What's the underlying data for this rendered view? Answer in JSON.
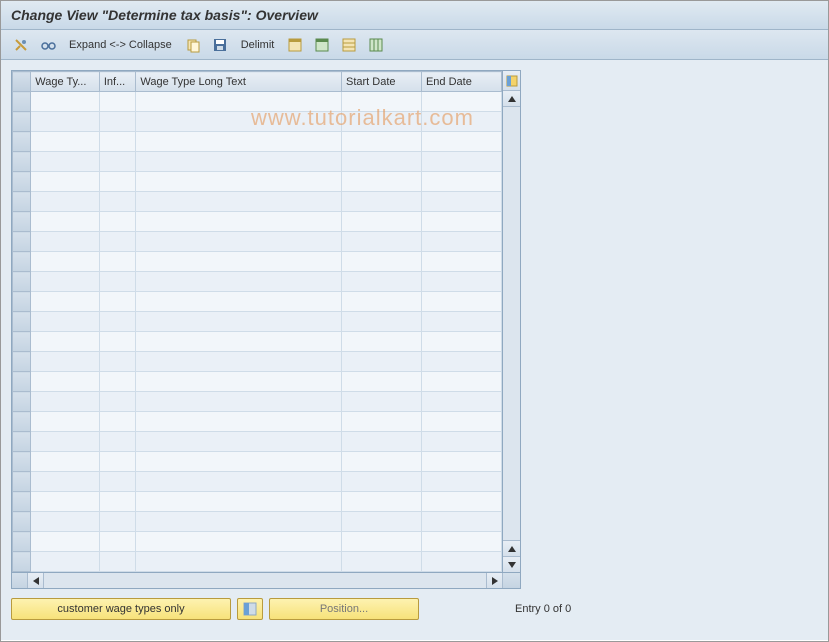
{
  "title": "Change View \"Determine tax basis\": Overview",
  "toolbar": {
    "expand_label": "Expand <-> Collapse",
    "delimit_label": "Delimit"
  },
  "table": {
    "columns": [
      "Wage Ty...",
      "Inf...",
      "Wage Type Long Text",
      "Start Date",
      "End Date"
    ],
    "rows": 24
  },
  "footer": {
    "customer_btn": "customer wage types only",
    "position_btn": "Position...",
    "entry_text": "Entry 0 of 0"
  },
  "watermark": "www.tutorialkart.com"
}
